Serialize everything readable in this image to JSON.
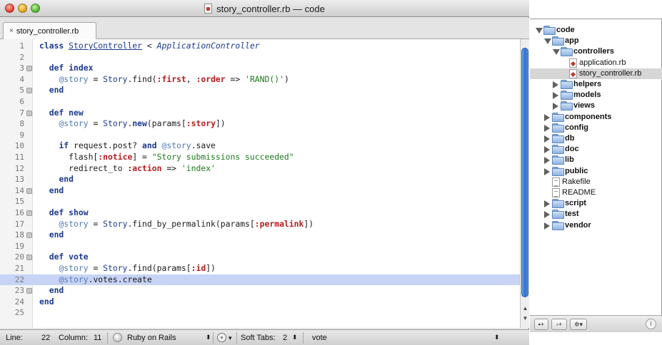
{
  "window": {
    "title": "story_controller.rb — code"
  },
  "tabs": [
    {
      "label": "story_controller.rb",
      "close": "×"
    }
  ],
  "editor": {
    "highlighted_line": 22,
    "lines": [
      {
        "n": "1",
        "fold": false,
        "tokens": [
          [
            "kw",
            "class"
          ],
          [
            "plain",
            " "
          ],
          [
            "cls",
            "StoryController"
          ],
          [
            "plain",
            " < "
          ],
          [
            "sup",
            "ApplicationController"
          ]
        ]
      },
      {
        "n": "2",
        "fold": false,
        "tokens": []
      },
      {
        "n": "3",
        "fold": true,
        "tokens": [
          [
            "plain",
            "  "
          ],
          [
            "kw",
            "def"
          ],
          [
            "plain",
            " "
          ],
          [
            "kw",
            "index"
          ]
        ]
      },
      {
        "n": "4",
        "fold": false,
        "tokens": [
          [
            "plain",
            "    "
          ],
          [
            "iv",
            "@story"
          ],
          [
            "plain",
            " = "
          ],
          [
            "const",
            "Story"
          ],
          [
            "plain",
            ".find("
          ],
          [
            "sym",
            ":first"
          ],
          [
            "plain",
            ", "
          ],
          [
            "sym",
            ":order"
          ],
          [
            "plain",
            " => "
          ],
          [
            "str",
            "'RAND()'"
          ],
          [
            "plain",
            ")"
          ]
        ]
      },
      {
        "n": "5",
        "fold": true,
        "tokens": [
          [
            "plain",
            "  "
          ],
          [
            "kw",
            "end"
          ]
        ]
      },
      {
        "n": "6",
        "fold": false,
        "tokens": []
      },
      {
        "n": "7",
        "fold": true,
        "tokens": [
          [
            "plain",
            "  "
          ],
          [
            "kw",
            "def"
          ],
          [
            "plain",
            " "
          ],
          [
            "kw",
            "new"
          ]
        ]
      },
      {
        "n": "8",
        "fold": false,
        "tokens": [
          [
            "plain",
            "    "
          ],
          [
            "iv",
            "@story"
          ],
          [
            "plain",
            " = "
          ],
          [
            "const",
            "Story"
          ],
          [
            "plain",
            "."
          ],
          [
            "kw",
            "new"
          ],
          [
            "plain",
            "(params["
          ],
          [
            "sym",
            ":story"
          ],
          [
            "plain",
            "])"
          ]
        ]
      },
      {
        "n": "9",
        "fold": false,
        "tokens": []
      },
      {
        "n": "10",
        "fold": false,
        "tokens": [
          [
            "plain",
            "    "
          ],
          [
            "kw",
            "if"
          ],
          [
            "plain",
            " request.post? "
          ],
          [
            "kw",
            "and"
          ],
          [
            "plain",
            " "
          ],
          [
            "iv",
            "@story"
          ],
          [
            "plain",
            ".save"
          ]
        ]
      },
      {
        "n": "11",
        "fold": false,
        "tokens": [
          [
            "plain",
            "      flash["
          ],
          [
            "sym",
            ":notice"
          ],
          [
            "plain",
            "] = "
          ],
          [
            "str",
            "\"Story submissions succeeded\""
          ]
        ]
      },
      {
        "n": "12",
        "fold": false,
        "tokens": [
          [
            "plain",
            "      redirect_to "
          ],
          [
            "sym",
            ":action"
          ],
          [
            "plain",
            " => "
          ],
          [
            "str",
            "'index'"
          ]
        ]
      },
      {
        "n": "13",
        "fold": false,
        "tokens": [
          [
            "plain",
            "    "
          ],
          [
            "kw",
            "end"
          ]
        ]
      },
      {
        "n": "14",
        "fold": true,
        "tokens": [
          [
            "plain",
            "  "
          ],
          [
            "kw",
            "end"
          ]
        ]
      },
      {
        "n": "15",
        "fold": false,
        "tokens": []
      },
      {
        "n": "16",
        "fold": true,
        "tokens": [
          [
            "plain",
            "  "
          ],
          [
            "kw",
            "def"
          ],
          [
            "plain",
            " "
          ],
          [
            "kw",
            "show"
          ]
        ]
      },
      {
        "n": "17",
        "fold": false,
        "tokens": [
          [
            "plain",
            "    "
          ],
          [
            "iv",
            "@story"
          ],
          [
            "plain",
            " = "
          ],
          [
            "const",
            "Story"
          ],
          [
            "plain",
            ".find_by_permalink(params["
          ],
          [
            "sym",
            ":permalink"
          ],
          [
            "plain",
            "])"
          ]
        ]
      },
      {
        "n": "18",
        "fold": true,
        "tokens": [
          [
            "plain",
            "  "
          ],
          [
            "kw",
            "end"
          ]
        ]
      },
      {
        "n": "19",
        "fold": false,
        "tokens": []
      },
      {
        "n": "20",
        "fold": true,
        "tokens": [
          [
            "plain",
            "  "
          ],
          [
            "kw",
            "def"
          ],
          [
            "plain",
            " "
          ],
          [
            "kw",
            "vote"
          ]
        ]
      },
      {
        "n": "21",
        "fold": false,
        "tokens": [
          [
            "plain",
            "    "
          ],
          [
            "iv",
            "@story"
          ],
          [
            "plain",
            " = "
          ],
          [
            "const",
            "Story"
          ],
          [
            "plain",
            ".find(params["
          ],
          [
            "sym",
            ":id"
          ],
          [
            "plain",
            "])"
          ]
        ]
      },
      {
        "n": "22",
        "fold": false,
        "tokens": [
          [
            "plain",
            "    "
          ],
          [
            "iv",
            "@story"
          ],
          [
            "plain",
            ".votes.create"
          ]
        ]
      },
      {
        "n": "23",
        "fold": true,
        "tokens": [
          [
            "plain",
            "  "
          ],
          [
            "kw",
            "end"
          ]
        ]
      },
      {
        "n": "24",
        "fold": false,
        "tokens": [
          [
            "kw",
            "end"
          ]
        ]
      },
      {
        "n": "25",
        "fold": false,
        "tokens": []
      }
    ]
  },
  "status": {
    "line_label": "Line:",
    "line_value": "22",
    "column_label": "Column:",
    "column_value": "11",
    "language": "Ruby on Rails",
    "language_arrows": "⬍",
    "gear_arrow": "▾",
    "soft_tabs_label": "Soft Tabs:",
    "soft_tabs_value": "2",
    "soft_tabs_arrows": "⬍",
    "symbol": "vote",
    "symbol_arrows": "⬍"
  },
  "project": {
    "nodes": [
      {
        "label": "code",
        "depth": 0,
        "type": "folder",
        "disc": "open",
        "bold": true,
        "selected": false
      },
      {
        "label": "app",
        "depth": 1,
        "type": "folder",
        "disc": "open",
        "bold": true,
        "selected": false
      },
      {
        "label": "controllers",
        "depth": 2,
        "type": "folder",
        "disc": "open",
        "bold": true,
        "selected": false
      },
      {
        "label": "application.rb",
        "depth": 3,
        "type": "rb",
        "disc": "none",
        "bold": false,
        "selected": false
      },
      {
        "label": "story_controller.rb",
        "depth": 3,
        "type": "rb",
        "disc": "none",
        "bold": false,
        "selected": true
      },
      {
        "label": "helpers",
        "depth": 2,
        "type": "folder",
        "disc": "closed",
        "bold": true,
        "selected": false
      },
      {
        "label": "models",
        "depth": 2,
        "type": "folder",
        "disc": "closed",
        "bold": true,
        "selected": false
      },
      {
        "label": "views",
        "depth": 2,
        "type": "folder",
        "disc": "closed",
        "bold": true,
        "selected": false
      },
      {
        "label": "components",
        "depth": 1,
        "type": "folder",
        "disc": "closed",
        "bold": true,
        "selected": false
      },
      {
        "label": "config",
        "depth": 1,
        "type": "folder",
        "disc": "closed",
        "bold": true,
        "selected": false
      },
      {
        "label": "db",
        "depth": 1,
        "type": "folder",
        "disc": "closed",
        "bold": true,
        "selected": false
      },
      {
        "label": "doc",
        "depth": 1,
        "type": "folder",
        "disc": "closed",
        "bold": true,
        "selected": false
      },
      {
        "label": "lib",
        "depth": 1,
        "type": "folder",
        "disc": "closed",
        "bold": true,
        "selected": false
      },
      {
        "label": "public",
        "depth": 1,
        "type": "folder",
        "disc": "closed",
        "bold": true,
        "selected": false
      },
      {
        "label": "Rakefile",
        "depth": 1,
        "type": "txt",
        "disc": "none",
        "bold": false,
        "selected": false
      },
      {
        "label": "README",
        "depth": 1,
        "type": "txt",
        "disc": "none",
        "bold": false,
        "selected": false
      },
      {
        "label": "script",
        "depth": 1,
        "type": "folder",
        "disc": "closed",
        "bold": true,
        "selected": false
      },
      {
        "label": "test",
        "depth": 1,
        "type": "folder",
        "disc": "closed",
        "bold": true,
        "selected": false
      },
      {
        "label": "vendor",
        "depth": 1,
        "type": "folder",
        "disc": "closed",
        "bold": true,
        "selected": false
      }
    ],
    "footer": {
      "new_file": "▪+",
      "new_folder": "▫+",
      "action_menu": "✲▾",
      "info": "i"
    }
  },
  "colors": {
    "selection_line": "#c8d4f5",
    "keyword": "#1b3a8f",
    "symbol": "#b31d1d",
    "string": "#1d7a1d",
    "ivar": "#4f79b8",
    "scroll_thumb": "#2e6fd0"
  }
}
